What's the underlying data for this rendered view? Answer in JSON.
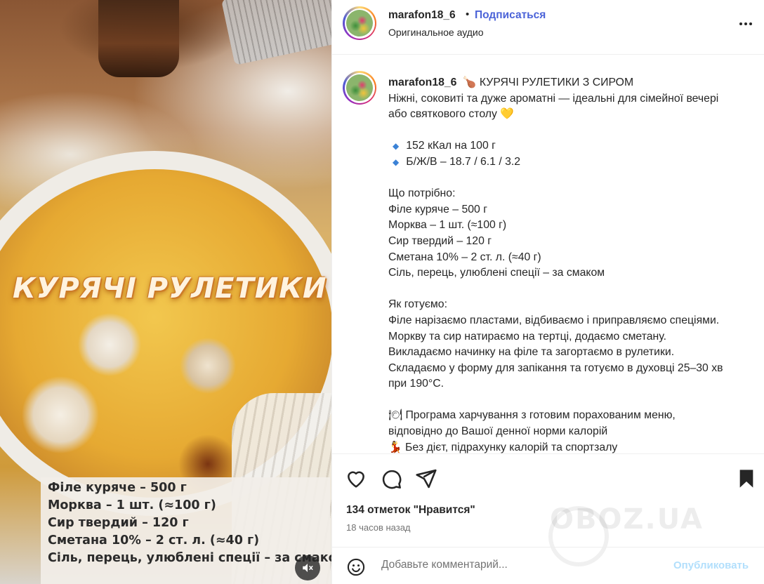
{
  "media": {
    "overlay_title": "КУРЯЧІ РУЛЕТИКИ",
    "ingredients": [
      "Філе куряче – 500 г",
      "Морква – 1 шт. (≈100 г)",
      "Сир твердий – 120 г",
      "Сметана 10% – 2 ст. л. (≈40 г)",
      "Сіль, перець, улюблені спеції – за смаком"
    ],
    "mute_icon": "speaker-muted-icon"
  },
  "header": {
    "username": "marafon18_6",
    "separator": "•",
    "follow_label": "Подписаться",
    "audio_label": "Оригинальное аудио",
    "more_icon": "more-horizontal-icon"
  },
  "caption": {
    "username": "marafon18_6",
    "first_line": "🍗 КУРЯЧІ РУЛЕТИКИ З СИРОМ",
    "lines": [
      "Ніжні, соковиті та дуже ароматні — ідеальні для сімейної вечері",
      "або святкового столу 💛",
      "",
      "152 кКал на 100 г",
      "Б/Ж/В – 18.7 / 6.1 / 3.2",
      "",
      "Що потрібно:",
      "Філе куряче – 500 г",
      "Морква – 1 шт. (≈100 г)",
      "Сир твердий – 120 г",
      "Сметана 10% – 2 ст. л. (≈40 г)",
      "Сіль, перець, улюблені спеції – за смаком",
      "",
      "Як готуємо:",
      "Філе нарізаємо пластами, відбиваємо і приправляємо спеціями.",
      "Моркву та сир натираємо на тертці, додаємо сметану.",
      "Викладаємо начинку на філе та загортаємо в рулетики.",
      "Складаємо у форму для запікання та готуємо в духовці 25–30 хв",
      "при 190°C.",
      "",
      "🍽 Програма харчування з готовим порахованим меню,",
      "відповідно до Вашої денної норми калорій",
      "💃 Без дієт, підрахунку калорій та спортзалу"
    ],
    "bullet_glyph": "🔹"
  },
  "actions": {
    "like_icon": "heart-icon",
    "comment_icon": "comment-icon",
    "share_icon": "share-icon",
    "save_icon": "bookmark-icon",
    "likes_text": "134 отметок \"Нравится\"",
    "time_ago": "18 часов назад",
    "watermark": "OBOZ.UA"
  },
  "comment_bar": {
    "emoji_icon": "emoji-icon",
    "placeholder": "Добавьте комментарий...",
    "publish_label": "Опубликовать"
  }
}
